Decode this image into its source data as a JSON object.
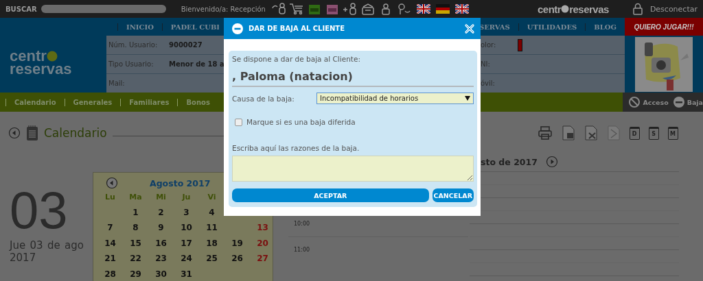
{
  "top_bar": {
    "search_label": "BUSCAR",
    "welcome": "Bienvenido/a: Recepción",
    "flags": [
      {
        "kind": "uk"
      },
      {
        "kind": "de"
      },
      {
        "kind": "uk"
      }
    ],
    "logo": {
      "left": "centr",
      "right": "reservas"
    },
    "logout": "Desconectar"
  },
  "header": {
    "logo": {
      "left": "centr",
      "right": "reservas"
    },
    "nav_left": [
      "INICIO",
      "PADEL CUBI"
    ],
    "nav_right": [
      "SERVAS",
      "UTILIDADES",
      "BLOG"
    ],
    "info_left": [
      {
        "label": "Núm. Usuario:",
        "value": "9000027"
      },
      {
        "label": "Tipo Usuario:",
        "value": "Menor de 18 a"
      },
      {
        "label": "Mail:"
      }
    ],
    "info_right": [
      {
        "label": "olor:",
        "color": "#7a0000"
      },
      {
        "label": "NI:"
      },
      {
        "label": "óvil:"
      }
    ],
    "promo": "QUIERO JUGAR!!!"
  },
  "subnav": {
    "tabs": [
      "Calendario",
      "Generales",
      "Familiares",
      "Bonos"
    ],
    "actions": [
      {
        "kind": "block",
        "label": "Acceso"
      },
      {
        "kind": "minus",
        "label": "Baja"
      }
    ]
  },
  "calendar": {
    "title": "Calendario",
    "toolbar": [
      {
        "kind": "print"
      },
      {
        "kind": "word"
      },
      {
        "kind": "excel"
      },
      {
        "kind": "pdf"
      },
      {
        "kind": "view",
        "label": "D"
      },
      {
        "kind": "view",
        "label": "S"
      },
      {
        "kind": "view",
        "label": "M"
      }
    ],
    "day_number": "03",
    "date": "Jue 03 de ago 2017",
    "mini": {
      "title": "Agosto 2017",
      "weekdays": [
        "Lu",
        "Ma",
        "Mi",
        "Ju",
        "Vi"
      ],
      "weeks": [
        [
          {
            "kind": "blank"
          },
          {
            "kind": "day",
            "day": "1"
          },
          {
            "kind": "day",
            "day": "2"
          },
          {
            "kind": "day",
            "day": "3"
          },
          {
            "kind": "day",
            "day": "4"
          }
        ],
        [
          {
            "kind": "day",
            "day": "7"
          },
          {
            "kind": "day",
            "day": "8"
          },
          {
            "kind": "day",
            "day": "9"
          },
          {
            "kind": "day",
            "day": "10"
          },
          {
            "kind": "day",
            "day": "11"
          },
          {
            "kind": "blank"
          },
          {
            "kind": "sunday",
            "day": "13"
          }
        ],
        [
          {
            "kind": "day",
            "day": "14"
          },
          {
            "kind": "day",
            "day": "15"
          },
          {
            "kind": "day",
            "day": "16"
          },
          {
            "kind": "day",
            "day": "17"
          },
          {
            "kind": "day",
            "day": "18"
          },
          {
            "kind": "day",
            "day": "19"
          },
          {
            "kind": "sunday",
            "day": "20"
          }
        ],
        [
          {
            "kind": "day",
            "day": "21"
          },
          {
            "kind": "day",
            "day": "22"
          },
          {
            "kind": "day",
            "day": "23"
          },
          {
            "kind": "day",
            "day": "24"
          },
          {
            "kind": "day",
            "day": "25"
          },
          {
            "kind": "day",
            "day": "26"
          },
          {
            "kind": "sunday",
            "day": "27"
          }
        ],
        [
          {
            "kind": "day",
            "day": "28"
          },
          {
            "kind": "day",
            "day": "29"
          },
          {
            "kind": "day",
            "day": "30"
          },
          {
            "kind": "day",
            "day": "31"
          }
        ]
      ]
    },
    "day_view": {
      "times": [
        "10:00",
        "11:00"
      ]
    },
    "week_view": {
      "title": "sto de 2017"
    }
  },
  "dialog": {
    "title": "DAR DE BAJA AL CLIENTE",
    "intro": "Se dispone a dar de baja al Cliente:",
    "client": ", Paloma (natacion)",
    "cause_label": "Causa de la baja:",
    "cause_value": "Incompatibilidad de horarios",
    "deferred": {
      "label": "Marque si es una baja diferida",
      "checked": false
    },
    "reasons_label": "Escriba aquí las razones de la baja.",
    "buttons": [
      "ACEPTAR",
      "CANCELAR"
    ]
  }
}
